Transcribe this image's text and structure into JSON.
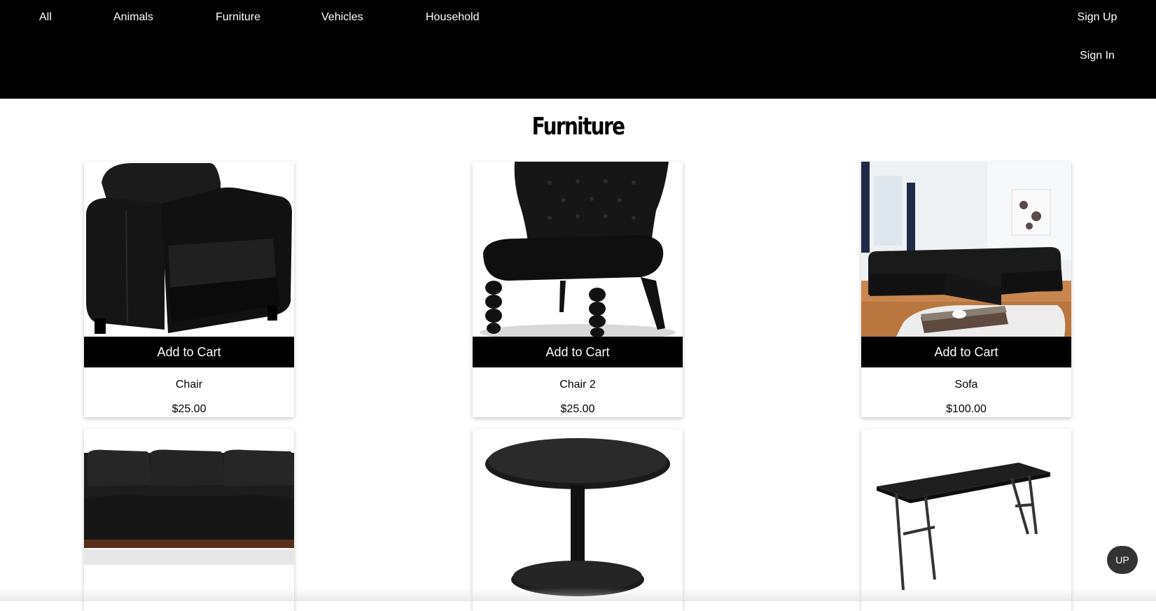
{
  "nav": {
    "links": [
      "All",
      "Animals",
      "Furniture",
      "Vehicles",
      "Household"
    ],
    "sign_up": "Sign Up",
    "sign_in": "Sign In"
  },
  "page": {
    "title": "Furniture"
  },
  "products": [
    {
      "name": "Chair",
      "price": "$25.00",
      "button": "Add to Cart",
      "image_icon": "armchair-icon"
    },
    {
      "name": "Chair 2",
      "price": "$25.00",
      "button": "Add to Cart",
      "image_icon": "tufted-chair-icon"
    },
    {
      "name": "Sofa",
      "price": "$100.00",
      "button": "Add to Cart",
      "image_icon": "sectional-sofa-icon"
    },
    {
      "image_icon": "couch-icon"
    },
    {
      "image_icon": "round-table-icon"
    },
    {
      "image_icon": "folding-table-icon"
    }
  ],
  "scroll": {
    "up_label": "UP"
  },
  "colors": {
    "header_bg": "#000000",
    "button_bg": "#000000",
    "up_button_bg": "#333333"
  }
}
